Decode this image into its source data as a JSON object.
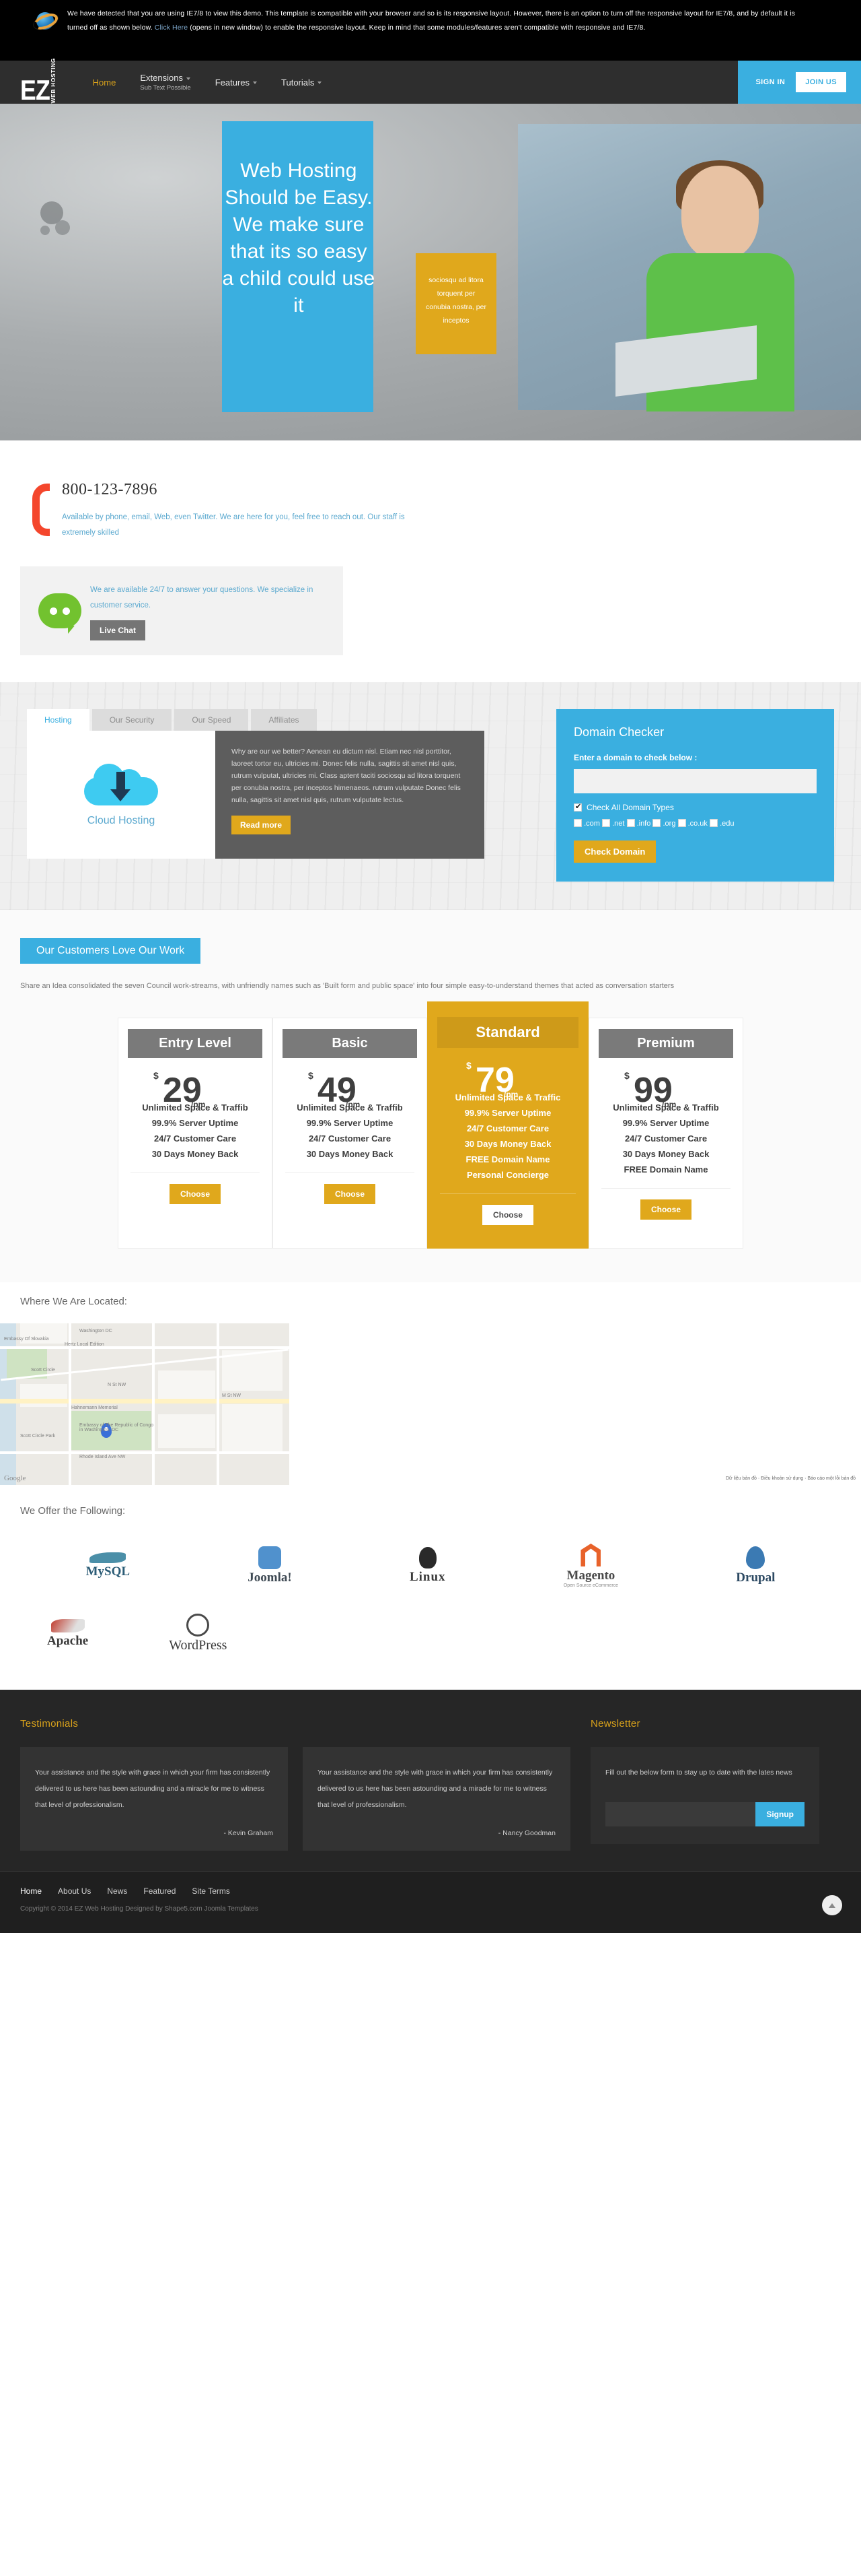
{
  "ie_notice": {
    "text_part1": "We have detected that you are using IE7/8 to view this demo. This template is compatible with your browser and so is its responsive layout. However, there is an option to turn off the responsive layout for IE7/8, and by default it is turned off as shown below. ",
    "link_label": "Click Here",
    "text_part2": " (opens in new window) to enable the responsive layout. Keep in mind that some modules/features aren't compatible with responsive and IE7/8.",
    "icon": "internet-explorer-icon"
  },
  "header": {
    "logo_main": "EZ",
    "logo_sub": "WEB HOSTING",
    "menu": [
      {
        "label": "Home",
        "sub": "",
        "active": true,
        "has_caret": false
      },
      {
        "label": "Extensions",
        "sub": "Sub Text Possible",
        "active": false,
        "has_caret": true
      },
      {
        "label": "Features",
        "sub": "",
        "active": false,
        "has_caret": true
      },
      {
        "label": "Tutorials",
        "sub": "",
        "active": false,
        "has_caret": true
      }
    ],
    "sign_in": "SIGN IN",
    "join_us": "JOIN US"
  },
  "hero": {
    "headline": "Web Hosting Should be Easy. We make sure that its so easy a child could use it",
    "gold_box": "sociosqu ad litora torquent per conubia nostra, per inceptos"
  },
  "contact": {
    "phone": "800-123-7896",
    "phone_desc": "Available by phone, email, Web, even Twitter. We are here for you, feel free to reach out. Our staff is extremely skilled",
    "chat_desc": "We are available 24/7 to answer your questions. We specialize in customer service.",
    "live_chat_label": "Live Chat"
  },
  "tabs": {
    "items": [
      {
        "label": "Hosting",
        "active": true
      },
      {
        "label": "Our Security",
        "active": false
      },
      {
        "label": "Our Speed",
        "active": false
      },
      {
        "label": "Affiliates",
        "active": false
      }
    ],
    "panel": {
      "icon_label": "Cloud Hosting",
      "body": "Why are our we better? Aenean eu dictum nisl. Etiam nec nisl porttitor, laoreet tortor eu, ultricies mi. Donec felis nulla, sagittis sit amet nisl quis, rutrum vulputat, ultricies mi. Class aptent taciti sociosqu ad litora torquent per conubia nostra, per inceptos himenaeos. rutrum vulputate Donec felis nulla, sagittis sit amet nisl quis, rutrum vulputate lectus.",
      "read_more": "Read more"
    }
  },
  "domain_checker": {
    "title": "Domain Checker",
    "label": "Enter a domain to check below :",
    "input_value": "",
    "input_placeholder": "",
    "check_all_label": "Check All Domain Types",
    "check_all_checked": true,
    "types": [
      ".com",
      ".net",
      ".info",
      ".org",
      ".co.uk",
      ".edu"
    ],
    "button_label": "Check Domain"
  },
  "pricing": {
    "heading": "Our Customers Love Our Work",
    "intro": "Share an Idea consolidated the seven Council work-streams, with unfriendly names such as 'Built form and public space' into four simple easy-to-understand themes that acted as conversation starters",
    "currency": "$",
    "per_label": "/pm",
    "choose_label": "Choose",
    "plans": [
      {
        "name": "Entry Level",
        "price": "29",
        "featured": false,
        "features": [
          "Unlimited Space & Traffib",
          "99.9% Server Uptime",
          "24/7 Customer Care",
          "30 Days Money Back"
        ]
      },
      {
        "name": "Basic",
        "price": "49",
        "featured": false,
        "features": [
          "Unlimited Space & Traffib",
          "99.9% Server Uptime",
          "24/7 Customer Care",
          "30 Days Money Back"
        ]
      },
      {
        "name": "Standard",
        "price": "79",
        "featured": true,
        "features": [
          "Unlimited Space & Traffic",
          "99.9% Server Uptime",
          "24/7 Customer Care",
          "30 Days Money Back",
          "FREE Domain Name",
          "Personal Concierge"
        ]
      },
      {
        "name": "Premium",
        "price": "99",
        "featured": false,
        "features": [
          "Unlimited Space & Traffib",
          "99.9% Server Uptime",
          "24/7 Customer Care",
          "30 Days Money Back",
          "FREE Domain Name"
        ]
      }
    ]
  },
  "map": {
    "title": "Where We Are Located:",
    "logo": "Google",
    "labels": [
      "Washington DC",
      "Hertz Local Edition",
      "Scott Circle",
      "Scott Circle Park",
      "N St NW",
      "Hahnemann Memorial",
      "Embassy of The Republic of Congo in Washington, DC",
      "Embassy Of Slovakia",
      "Rhode Island Ave NW",
      "M St NW"
    ],
    "credit": "Dữ liệu bản đồ · Điều khoản sử dụng · Báo cáo một lỗi bản đồ"
  },
  "brands": {
    "title": "We Offer the Following:",
    "row1": [
      {
        "name": "MySQL",
        "key": "mysql",
        "sub": ""
      },
      {
        "name": "Joomla!",
        "key": "joomla",
        "sub": ""
      },
      {
        "name": "Linux",
        "key": "linux",
        "sub": ""
      },
      {
        "name": "Magento",
        "key": "magento",
        "sub": "Open Source eCommerce"
      },
      {
        "name": "Drupal",
        "key": "drupal",
        "sub": ""
      }
    ],
    "row2": [
      {
        "name": "Apache",
        "key": "apache",
        "sub": ""
      },
      {
        "name": "WordPress",
        "key": "wordpress",
        "sub": ""
      }
    ]
  },
  "footer": {
    "testimonials_title": "Testimonials",
    "testimonials": [
      {
        "quote": "Your assistance and the style with grace in which your firm has consistently delivered to us here has been astounding and a miracle for me to witness that level of professionalism.",
        "author": "- Kevin Graham"
      },
      {
        "quote": "Your assistance and the style with grace in which your firm has consistently delivered to us here has been astounding and a miracle for me to witness that level of professionalism.",
        "author": "- Nancy Goodman"
      }
    ],
    "newsletter_title": "Newsletter",
    "newsletter_desc": "Fill out the below form to stay up to date with the lates news",
    "newsletter_value": "",
    "newsletter_placeholder": "",
    "signup_label": "Signup",
    "bottom_links": [
      "Home",
      "About Us",
      "News",
      "Featured",
      "Site Terms"
    ],
    "copyright": "Copyright © 2014  EZ Web Hosting  Designed by Shape5.com Joomla Templates"
  }
}
